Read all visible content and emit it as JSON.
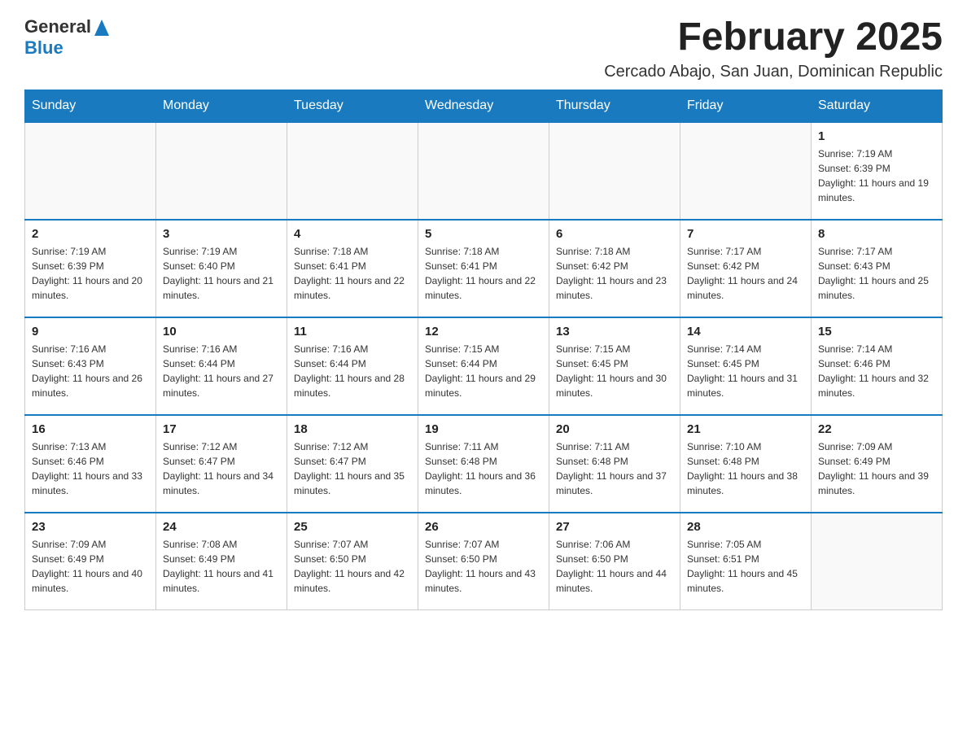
{
  "header": {
    "logo_general": "General",
    "logo_blue": "Blue",
    "month_title": "February 2025",
    "location": "Cercado Abajo, San Juan, Dominican Republic"
  },
  "weekdays": [
    "Sunday",
    "Monday",
    "Tuesday",
    "Wednesday",
    "Thursday",
    "Friday",
    "Saturday"
  ],
  "weeks": [
    [
      {
        "day": "",
        "sunrise": "",
        "sunset": "",
        "daylight": ""
      },
      {
        "day": "",
        "sunrise": "",
        "sunset": "",
        "daylight": ""
      },
      {
        "day": "",
        "sunrise": "",
        "sunset": "",
        "daylight": ""
      },
      {
        "day": "",
        "sunrise": "",
        "sunset": "",
        "daylight": ""
      },
      {
        "day": "",
        "sunrise": "",
        "sunset": "",
        "daylight": ""
      },
      {
        "day": "",
        "sunrise": "",
        "sunset": "",
        "daylight": ""
      },
      {
        "day": "1",
        "sunrise": "Sunrise: 7:19 AM",
        "sunset": "Sunset: 6:39 PM",
        "daylight": "Daylight: 11 hours and 19 minutes."
      }
    ],
    [
      {
        "day": "2",
        "sunrise": "Sunrise: 7:19 AM",
        "sunset": "Sunset: 6:39 PM",
        "daylight": "Daylight: 11 hours and 20 minutes."
      },
      {
        "day": "3",
        "sunrise": "Sunrise: 7:19 AM",
        "sunset": "Sunset: 6:40 PM",
        "daylight": "Daylight: 11 hours and 21 minutes."
      },
      {
        "day": "4",
        "sunrise": "Sunrise: 7:18 AM",
        "sunset": "Sunset: 6:41 PM",
        "daylight": "Daylight: 11 hours and 22 minutes."
      },
      {
        "day": "5",
        "sunrise": "Sunrise: 7:18 AM",
        "sunset": "Sunset: 6:41 PM",
        "daylight": "Daylight: 11 hours and 22 minutes."
      },
      {
        "day": "6",
        "sunrise": "Sunrise: 7:18 AM",
        "sunset": "Sunset: 6:42 PM",
        "daylight": "Daylight: 11 hours and 23 minutes."
      },
      {
        "day": "7",
        "sunrise": "Sunrise: 7:17 AM",
        "sunset": "Sunset: 6:42 PM",
        "daylight": "Daylight: 11 hours and 24 minutes."
      },
      {
        "day": "8",
        "sunrise": "Sunrise: 7:17 AM",
        "sunset": "Sunset: 6:43 PM",
        "daylight": "Daylight: 11 hours and 25 minutes."
      }
    ],
    [
      {
        "day": "9",
        "sunrise": "Sunrise: 7:16 AM",
        "sunset": "Sunset: 6:43 PM",
        "daylight": "Daylight: 11 hours and 26 minutes."
      },
      {
        "day": "10",
        "sunrise": "Sunrise: 7:16 AM",
        "sunset": "Sunset: 6:44 PM",
        "daylight": "Daylight: 11 hours and 27 minutes."
      },
      {
        "day": "11",
        "sunrise": "Sunrise: 7:16 AM",
        "sunset": "Sunset: 6:44 PM",
        "daylight": "Daylight: 11 hours and 28 minutes."
      },
      {
        "day": "12",
        "sunrise": "Sunrise: 7:15 AM",
        "sunset": "Sunset: 6:44 PM",
        "daylight": "Daylight: 11 hours and 29 minutes."
      },
      {
        "day": "13",
        "sunrise": "Sunrise: 7:15 AM",
        "sunset": "Sunset: 6:45 PM",
        "daylight": "Daylight: 11 hours and 30 minutes."
      },
      {
        "day": "14",
        "sunrise": "Sunrise: 7:14 AM",
        "sunset": "Sunset: 6:45 PM",
        "daylight": "Daylight: 11 hours and 31 minutes."
      },
      {
        "day": "15",
        "sunrise": "Sunrise: 7:14 AM",
        "sunset": "Sunset: 6:46 PM",
        "daylight": "Daylight: 11 hours and 32 minutes."
      }
    ],
    [
      {
        "day": "16",
        "sunrise": "Sunrise: 7:13 AM",
        "sunset": "Sunset: 6:46 PM",
        "daylight": "Daylight: 11 hours and 33 minutes."
      },
      {
        "day": "17",
        "sunrise": "Sunrise: 7:12 AM",
        "sunset": "Sunset: 6:47 PM",
        "daylight": "Daylight: 11 hours and 34 minutes."
      },
      {
        "day": "18",
        "sunrise": "Sunrise: 7:12 AM",
        "sunset": "Sunset: 6:47 PM",
        "daylight": "Daylight: 11 hours and 35 minutes."
      },
      {
        "day": "19",
        "sunrise": "Sunrise: 7:11 AM",
        "sunset": "Sunset: 6:48 PM",
        "daylight": "Daylight: 11 hours and 36 minutes."
      },
      {
        "day": "20",
        "sunrise": "Sunrise: 7:11 AM",
        "sunset": "Sunset: 6:48 PM",
        "daylight": "Daylight: 11 hours and 37 minutes."
      },
      {
        "day": "21",
        "sunrise": "Sunrise: 7:10 AM",
        "sunset": "Sunset: 6:48 PM",
        "daylight": "Daylight: 11 hours and 38 minutes."
      },
      {
        "day": "22",
        "sunrise": "Sunrise: 7:09 AM",
        "sunset": "Sunset: 6:49 PM",
        "daylight": "Daylight: 11 hours and 39 minutes."
      }
    ],
    [
      {
        "day": "23",
        "sunrise": "Sunrise: 7:09 AM",
        "sunset": "Sunset: 6:49 PM",
        "daylight": "Daylight: 11 hours and 40 minutes."
      },
      {
        "day": "24",
        "sunrise": "Sunrise: 7:08 AM",
        "sunset": "Sunset: 6:49 PM",
        "daylight": "Daylight: 11 hours and 41 minutes."
      },
      {
        "day": "25",
        "sunrise": "Sunrise: 7:07 AM",
        "sunset": "Sunset: 6:50 PM",
        "daylight": "Daylight: 11 hours and 42 minutes."
      },
      {
        "day": "26",
        "sunrise": "Sunrise: 7:07 AM",
        "sunset": "Sunset: 6:50 PM",
        "daylight": "Daylight: 11 hours and 43 minutes."
      },
      {
        "day": "27",
        "sunrise": "Sunrise: 7:06 AM",
        "sunset": "Sunset: 6:50 PM",
        "daylight": "Daylight: 11 hours and 44 minutes."
      },
      {
        "day": "28",
        "sunrise": "Sunrise: 7:05 AM",
        "sunset": "Sunset: 6:51 PM",
        "daylight": "Daylight: 11 hours and 45 minutes."
      },
      {
        "day": "",
        "sunrise": "",
        "sunset": "",
        "daylight": ""
      }
    ]
  ]
}
